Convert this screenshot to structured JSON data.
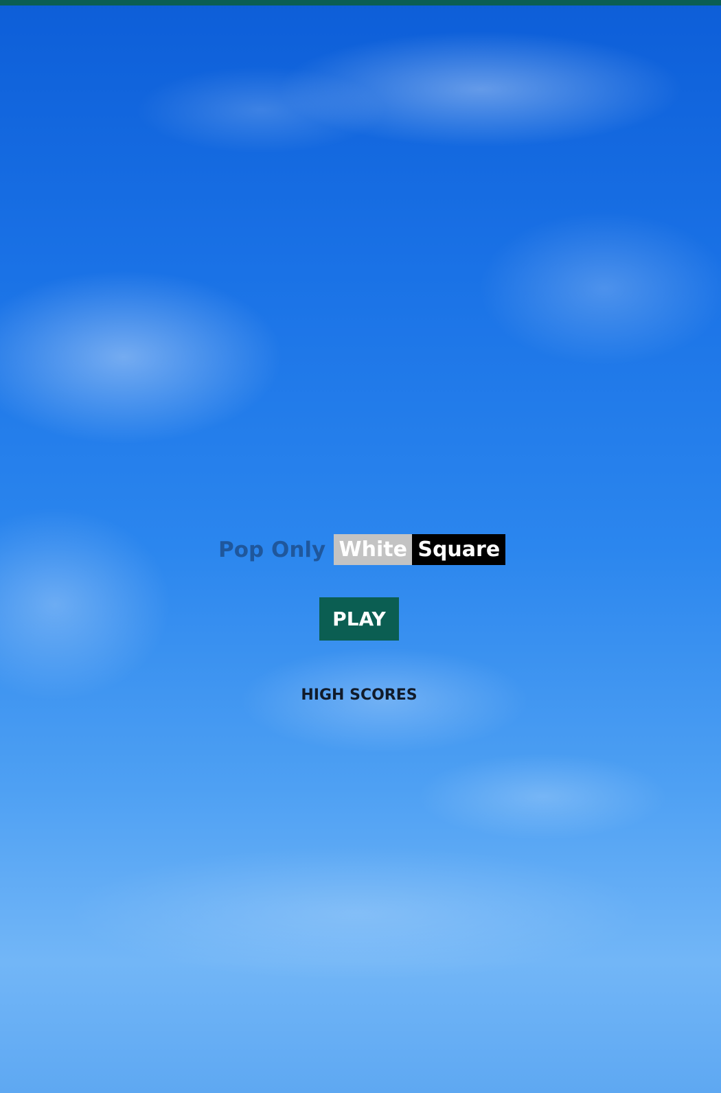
{
  "title": {
    "prefix": "Pop Only",
    "white_word": "White",
    "square_word": "Square"
  },
  "menu": {
    "play_label": "PLAY",
    "high_scores_label": "HIGH SCORES"
  },
  "colors": {
    "accent_green": "#0b5e52",
    "white_tile": "#c3c3c3",
    "black_tile": "#000000",
    "sky_blue": "#2f8ae6"
  }
}
